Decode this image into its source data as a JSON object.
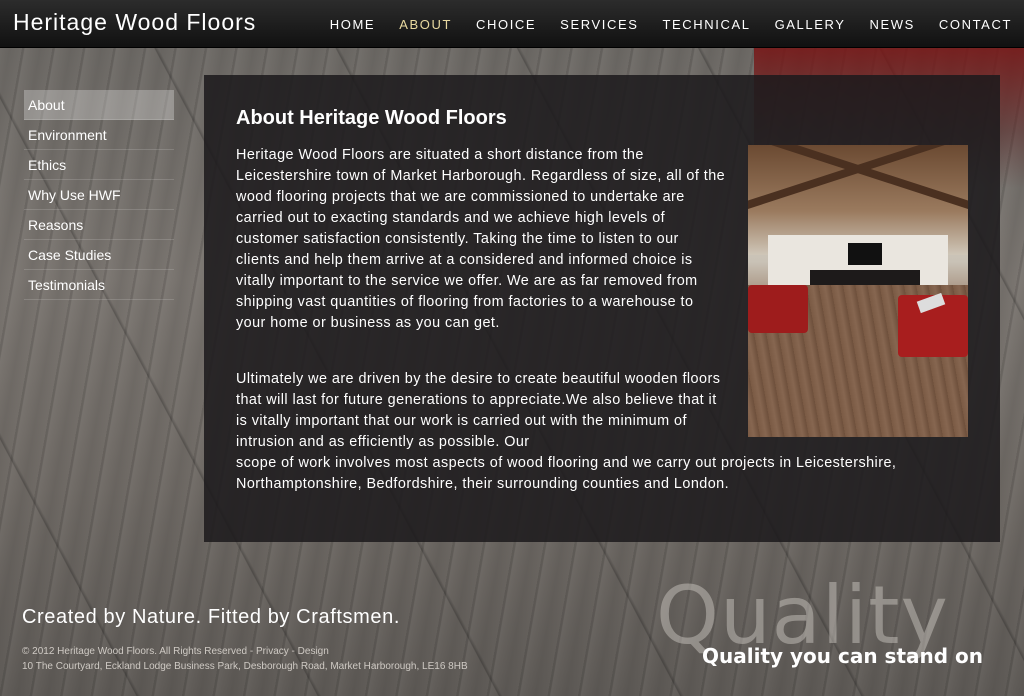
{
  "site": {
    "title": "Heritage Wood Floors"
  },
  "nav": {
    "items": [
      {
        "label": "HOME"
      },
      {
        "label": "ABOUT"
      },
      {
        "label": "CHOICE"
      },
      {
        "label": "SERVICES"
      },
      {
        "label": "TECHNICAL"
      },
      {
        "label": "GALLERY"
      },
      {
        "label": "NEWS"
      },
      {
        "label": "CONTACT"
      }
    ],
    "active": "ABOUT"
  },
  "sidebar": {
    "items": [
      {
        "label": "About"
      },
      {
        "label": "Environment"
      },
      {
        "label": "Ethics"
      },
      {
        "label": "Why Use HWF"
      },
      {
        "label": "Reasons"
      },
      {
        "label": "Case Studies"
      },
      {
        "label": "Testimonials"
      }
    ],
    "active": "About"
  },
  "main": {
    "title": "About Heritage Wood Floors",
    "para1": "Heritage Wood Floors are situated a short distance from the Leicestershire town of Market Harborough. Regardless of size, all of the wood flooring projects that we are commissioned to undertake are carried out to exacting standards and we achieve high levels of customer satisfaction consistently. Taking the time to listen to our clients and help them arrive at a considered and informed choice is vitally important to the service we offer. We are as far removed from shipping vast quantities of flooring from factories to a warehouse to your home or business as you can get.",
    "para2_a": "Ultimately we are driven by the desire to create beautiful wooden floors that will last for future generations to appreciate.We also believe that it is vitally important that our work is carried out with the minimum of intrusion and as efficiently as possible. Our",
    "para2_b": "scope of work involves most aspects of wood flooring and we carry out projects in Leicestershire, Northamptonshire, Bedfordshire, their surrounding counties and London."
  },
  "footer": {
    "tagline": "Created by Nature. Fitted by Craftsmen.",
    "copyright": "© 2012 Heritage Wood Floors. All Rights Reserved - ",
    "privacy": "Privacy",
    "sep": " - ",
    "design": "Design",
    "address": "10 The Courtyard, Eckland Lodge Business Park, Desborough Road, Market Harborough, LE16 8HB"
  },
  "quality": {
    "big": "Quality",
    "small": "Quality you can stand on"
  },
  "colors": {
    "active_nav": "#e8d9a0",
    "panel_bg": "#1c1a1c"
  }
}
